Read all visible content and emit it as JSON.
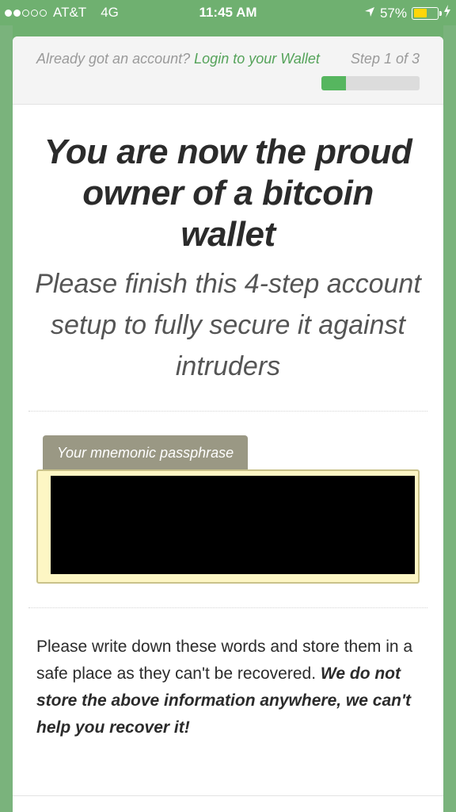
{
  "status_bar": {
    "carrier": "AT&T",
    "network": "4G",
    "time": "11:45 AM",
    "battery": "57%",
    "battery_level": 0.57,
    "signal_bars": 2,
    "icons": [
      "signal-dots-icon",
      "location-arrow-icon",
      "battery-icon",
      "charging-bolt-icon"
    ]
  },
  "header": {
    "already_text": "Already got an account?",
    "login_link": "Login to your Wallet",
    "step_label": "Step 1 of 3",
    "progress": 0.25
  },
  "main": {
    "headline": "You are now the proud owner of a bitcoin wallet",
    "subline": "Please finish this 4-step account setup to fully secure it against intruders",
    "mnemonic_label": "Your mnemonic passphrase",
    "notice_text": "Please write down these words and store them in a safe place as they can't be recovered.",
    "notice_strong": "We do not store the above information anywhere, we can't help you recover it!"
  },
  "colors": {
    "accent_green": "#56b65f",
    "background_green": "#7ab37c",
    "mnemonic_bg": "#fdf6c4",
    "tab_bg": "#9a9884"
  }
}
